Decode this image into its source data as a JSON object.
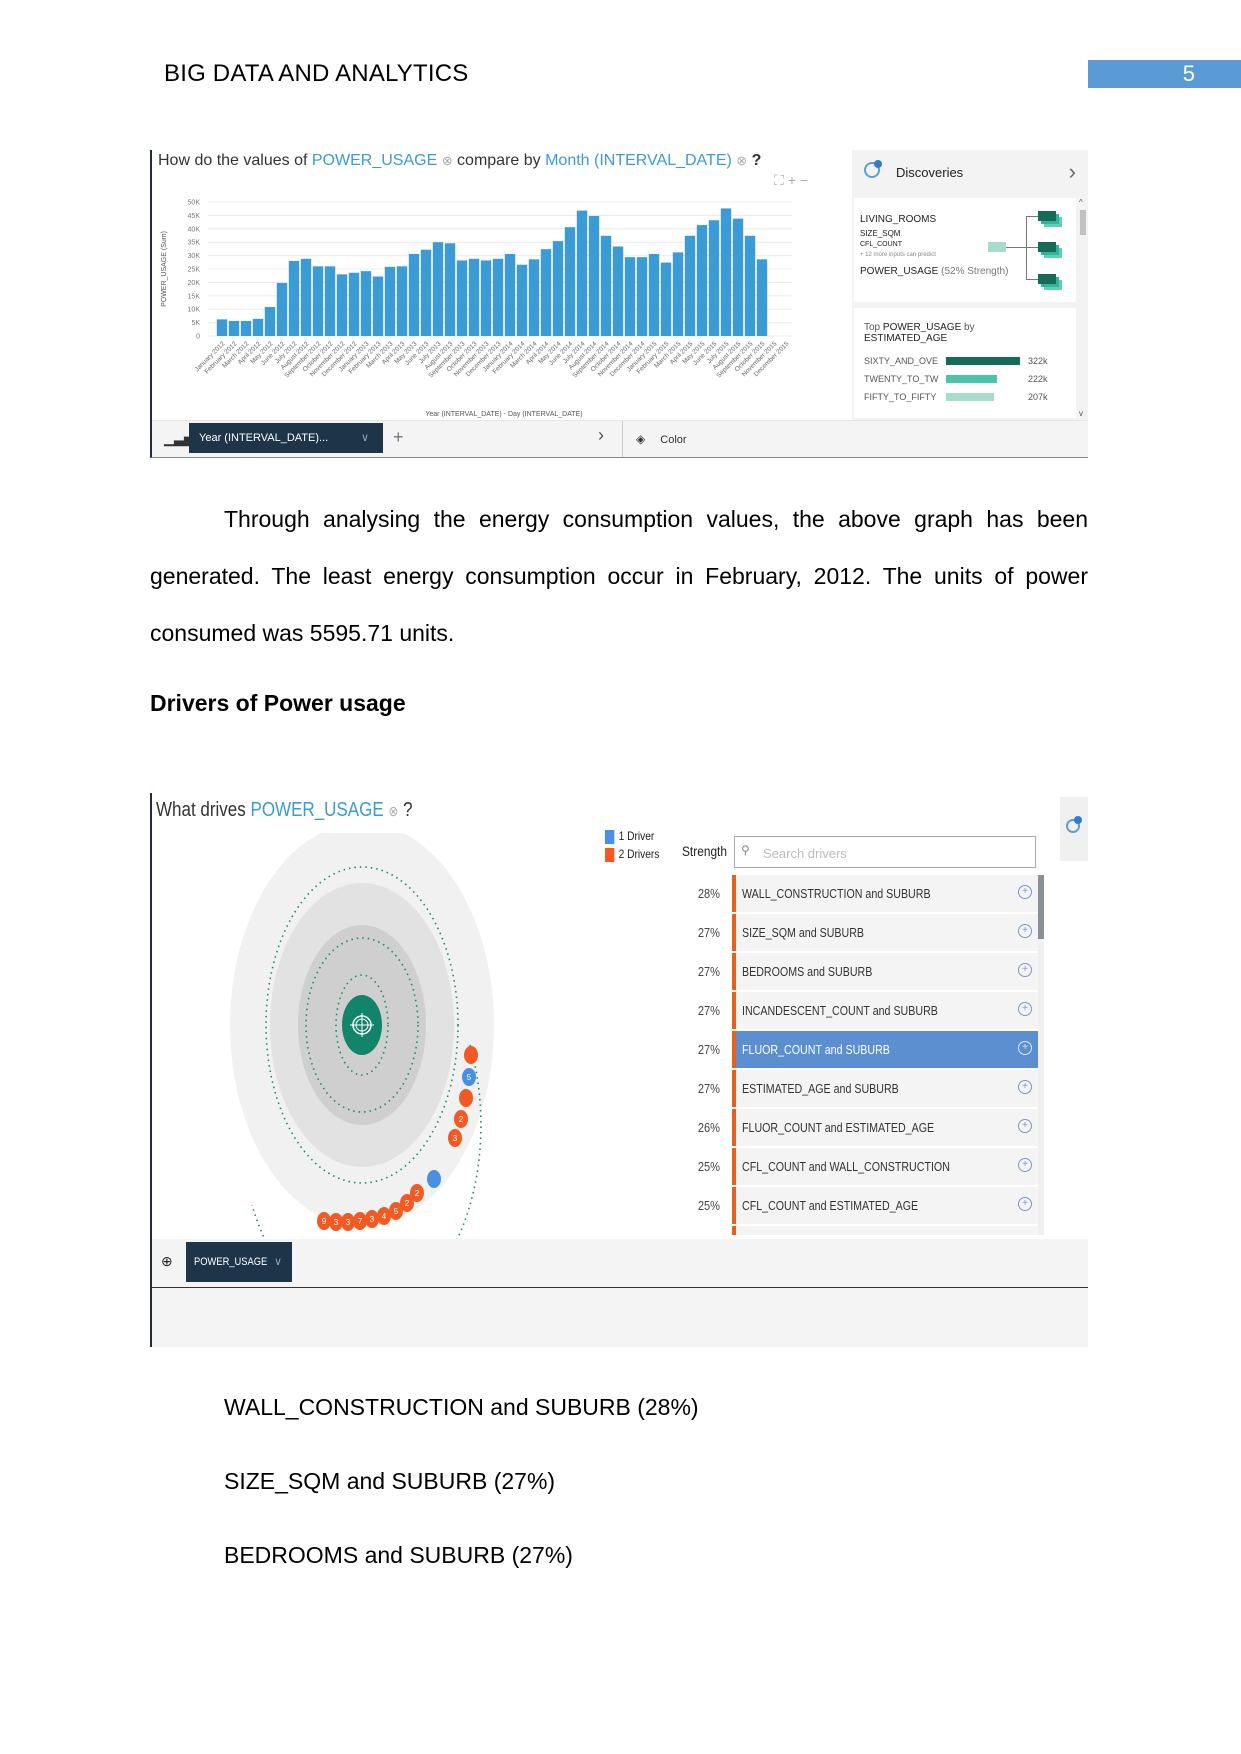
{
  "header": {
    "title": "BIG DATA AND ANALYTICS",
    "page_number": "5"
  },
  "figure1": {
    "question_prefix": "How do the values of",
    "measure": "POWER_USAGE",
    "question_mid": "compare by",
    "dimension": "Month (INTERVAL_DATE)",
    "question_suffix": "?",
    "remove_glyph": "⊗",
    "toolbar": {
      "chart_type_icon": "bar-chart-icon",
      "dimension_pill": "Year (INTERVAL_DATE)...",
      "chevron": "∨",
      "add": "+",
      "next": "›",
      "color_label": "Color"
    },
    "discoveries": {
      "title": "Discoveries",
      "inputs": [
        "LIVING_ROOMS",
        "SIZE_SQM",
        "CFL_COUNT"
      ],
      "more_inputs": "+ 12 more inputs can predict",
      "target": "POWER_USAGE",
      "strength": "(52% Strength)",
      "top_title_prefix": "Top",
      "top_measure": "POWER_USAGE",
      "top_by": "by",
      "top_dimension": "ESTIMATED_AGE",
      "top_rows": [
        {
          "label": "SIXTY_AND_OVE",
          "value": "322k",
          "amount": 322,
          "color": "#146b57"
        },
        {
          "label": "TWENTY_TO_TW",
          "value": "222k",
          "amount": 222,
          "color": "#4cc3aa"
        },
        {
          "label": "FIFTY_TO_FIFTY",
          "value": "207k",
          "amount": 207,
          "color": "#a7dccd"
        }
      ]
    }
  },
  "chart_data": {
    "type": "bar",
    "title": "How do the values of POWER_USAGE compare by Month (INTERVAL_DATE)?",
    "xlabel": "Year (INTERVAL_DATE) - Day (INTERVAL_DATE)",
    "ylabel": "POWER_USAGE (Sum)",
    "ylim": [
      0,
      50000
    ],
    "yticks": [
      0,
      5000,
      10000,
      15000,
      20000,
      25000,
      30000,
      35000,
      40000,
      45000,
      50000
    ],
    "ytick_labels": [
      "0",
      "5K",
      "10K",
      "15K",
      "20K",
      "25K",
      "30K",
      "35K",
      "40K",
      "45K",
      "50K"
    ],
    "grid": true,
    "color": "#3a9bd6",
    "categories": [
      "January 2012",
      "February 2012",
      "March 2012",
      "April 2012",
      "May 2012",
      "June 2012",
      "July 2012",
      "August 2012",
      "September 2012",
      "October 2012",
      "November 2012",
      "December 2012",
      "January 2013",
      "February 2013",
      "March 2013",
      "April 2013",
      "May 2013",
      "June 2013",
      "July 2013",
      "August 2013",
      "September 2013",
      "October 2013",
      "November 2013",
      "December 2013",
      "January 2014",
      "February 2014",
      "March 2014",
      "April 2014",
      "May 2014",
      "June 2014",
      "July 2014",
      "August 2014",
      "September 2014",
      "October 2014",
      "November 2014",
      "December 2014",
      "January 2015",
      "February 2015",
      "March 2015",
      "April 2015",
      "May 2015",
      "June 2015",
      "July 2015",
      "August 2015",
      "September 2015",
      "October 2015",
      "November 2015",
      "December 2015"
    ],
    "values": [
      6200,
      5596,
      5600,
      6400,
      10800,
      19800,
      28000,
      28800,
      26000,
      26000,
      23000,
      23600,
      24200,
      22200,
      25800,
      26000,
      30600,
      32200,
      35000,
      34600,
      28200,
      28800,
      28200,
      28800,
      30600,
      26600,
      28600,
      32400,
      35400,
      40600,
      46800,
      44800,
      37400,
      33400,
      29400,
      29400,
      30600,
      27400,
      31200,
      37400,
      41400,
      43200,
      47600,
      43800,
      37400,
      28600,
      null,
      null
    ]
  },
  "body": {
    "paragraph1": "Through analysing the energy consumption values, the above graph has been generated. The least energy consumption occur in February, 2012. The units of power consumed was 5595.71 units.",
    "heading": "Drivers of Power usage",
    "list": [
      "WALL_CONSTRUCTION and SUBURB (28%)",
      "SIZE_SQM and SUBURB (27%)",
      "BEDROOMS and SUBURB (27%)"
    ]
  },
  "figure2": {
    "question_prefix": "What drives",
    "measure": "POWER_USAGE",
    "question_suffix": "?",
    "remove_glyph": "⊗",
    "legend": [
      {
        "label": "1 Driver",
        "color": "#4a90e2"
      },
      {
        "label": "2 Drivers",
        "color": "#f15a22"
      }
    ],
    "strength_label": "Strength",
    "search_placeholder": "Search drivers",
    "drivers": [
      {
        "strength": "28%",
        "label": "WALL_CONSTRUCTION and SUBURB",
        "selected": false
      },
      {
        "strength": "27%",
        "label": "SIZE_SQM and SUBURB",
        "selected": false
      },
      {
        "strength": "27%",
        "label": "BEDROOMS and SUBURB",
        "selected": false
      },
      {
        "strength": "27%",
        "label": "INCANDESCENT_COUNT and SUBURB",
        "selected": false
      },
      {
        "strength": "27%",
        "label": "FLUOR_COUNT and SUBURB",
        "selected": true
      },
      {
        "strength": "27%",
        "label": "ESTIMATED_AGE and SUBURB",
        "selected": false
      },
      {
        "strength": "26%",
        "label": "FLUOR_COUNT and ESTIMATED_AGE",
        "selected": false
      },
      {
        "strength": "25%",
        "label": "CFL_COUNT and WALL_CONSTRUCTION",
        "selected": false
      },
      {
        "strength": "25%",
        "label": "CFL_COUNT and ESTIMATED_AGE",
        "selected": false
      }
    ],
    "orbit_nodes": [
      {
        "type": "2",
        "count": ""
      },
      {
        "type": "1",
        "count": "5"
      },
      {
        "type": "2",
        "count": ""
      },
      {
        "type": "2",
        "count": "2"
      },
      {
        "type": "2",
        "count": "3"
      },
      {
        "type": "1",
        "count": ""
      },
      {
        "type": "2",
        "count": "2"
      },
      {
        "type": "2",
        "count": "2"
      },
      {
        "type": "2",
        "count": "5"
      },
      {
        "type": "2",
        "count": "4"
      },
      {
        "type": "2",
        "count": "3"
      },
      {
        "type": "2",
        "count": "7"
      },
      {
        "type": "2",
        "count": "3"
      },
      {
        "type": "2",
        "count": "3"
      },
      {
        "type": "2",
        "count": "9"
      }
    ],
    "target_pill": "POWER_USAGE",
    "chevron": "∨"
  }
}
